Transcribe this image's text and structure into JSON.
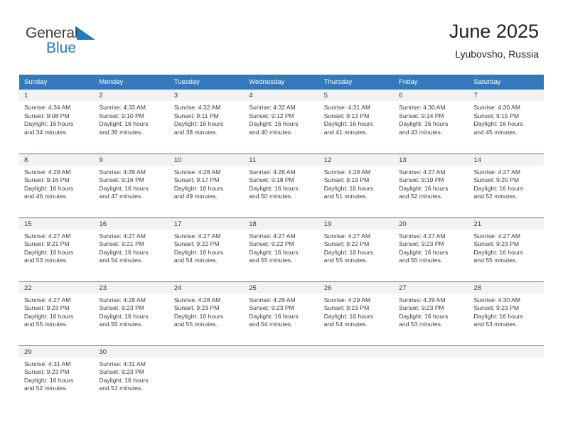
{
  "brand": {
    "name_part1": "General",
    "name_part2": "Blue",
    "triangle_color": "#1e7bc4",
    "text_color": "#3b3b3b"
  },
  "header": {
    "title": "June 2025",
    "subtitle": "Lyubovsho, Russia",
    "accent_color": "#3479ba"
  },
  "calendar": {
    "weekday_headers": [
      "Sunday",
      "Monday",
      "Tuesday",
      "Wednesday",
      "Thursday",
      "Friday",
      "Saturday"
    ],
    "weeks": [
      [
        {
          "day": "1",
          "sunrise": "Sunrise: 4:34 AM",
          "sunset": "Sunset: 9:08 PM",
          "daylight1": "Daylight: 16 hours",
          "daylight2": "and 34 minutes."
        },
        {
          "day": "2",
          "sunrise": "Sunrise: 4:33 AM",
          "sunset": "Sunset: 9:10 PM",
          "daylight1": "Daylight: 16 hours",
          "daylight2": "and 36 minutes."
        },
        {
          "day": "3",
          "sunrise": "Sunrise: 4:32 AM",
          "sunset": "Sunset: 9:11 PM",
          "daylight1": "Daylight: 16 hours",
          "daylight2": "and 38 minutes."
        },
        {
          "day": "4",
          "sunrise": "Sunrise: 4:32 AM",
          "sunset": "Sunset: 9:12 PM",
          "daylight1": "Daylight: 16 hours",
          "daylight2": "and 40 minutes."
        },
        {
          "day": "5",
          "sunrise": "Sunrise: 4:31 AM",
          "sunset": "Sunset: 9:13 PM",
          "daylight1": "Daylight: 16 hours",
          "daylight2": "and 41 minutes."
        },
        {
          "day": "6",
          "sunrise": "Sunrise: 4:30 AM",
          "sunset": "Sunset: 9:14 PM",
          "daylight1": "Daylight: 16 hours",
          "daylight2": "and 43 minutes."
        },
        {
          "day": "7",
          "sunrise": "Sunrise: 4:30 AM",
          "sunset": "Sunset: 9:15 PM",
          "daylight1": "Daylight: 16 hours",
          "daylight2": "and 45 minutes."
        }
      ],
      [
        {
          "day": "8",
          "sunrise": "Sunrise: 4:29 AM",
          "sunset": "Sunset: 9:16 PM",
          "daylight1": "Daylight: 16 hours",
          "daylight2": "and 46 minutes."
        },
        {
          "day": "9",
          "sunrise": "Sunrise: 4:29 AM",
          "sunset": "Sunset: 9:16 PM",
          "daylight1": "Daylight: 16 hours",
          "daylight2": "and 47 minutes."
        },
        {
          "day": "10",
          "sunrise": "Sunrise: 4:28 AM",
          "sunset": "Sunset: 9:17 PM",
          "daylight1": "Daylight: 16 hours",
          "daylight2": "and 49 minutes."
        },
        {
          "day": "11",
          "sunrise": "Sunrise: 4:28 AM",
          "sunset": "Sunset: 9:18 PM",
          "daylight1": "Daylight: 16 hours",
          "daylight2": "and 50 minutes."
        },
        {
          "day": "12",
          "sunrise": "Sunrise: 4:28 AM",
          "sunset": "Sunset: 9:19 PM",
          "daylight1": "Daylight: 16 hours",
          "daylight2": "and 51 minutes."
        },
        {
          "day": "13",
          "sunrise": "Sunrise: 4:27 AM",
          "sunset": "Sunset: 9:19 PM",
          "daylight1": "Daylight: 16 hours",
          "daylight2": "and 52 minutes."
        },
        {
          "day": "14",
          "sunrise": "Sunrise: 4:27 AM",
          "sunset": "Sunset: 9:20 PM",
          "daylight1": "Daylight: 16 hours",
          "daylight2": "and 52 minutes."
        }
      ],
      [
        {
          "day": "15",
          "sunrise": "Sunrise: 4:27 AM",
          "sunset": "Sunset: 9:21 PM",
          "daylight1": "Daylight: 16 hours",
          "daylight2": "and 53 minutes."
        },
        {
          "day": "16",
          "sunrise": "Sunrise: 4:27 AM",
          "sunset": "Sunset: 9:21 PM",
          "daylight1": "Daylight: 16 hours",
          "daylight2": "and 54 minutes."
        },
        {
          "day": "17",
          "sunrise": "Sunrise: 4:27 AM",
          "sunset": "Sunset: 9:22 PM",
          "daylight1": "Daylight: 16 hours",
          "daylight2": "and 54 minutes."
        },
        {
          "day": "18",
          "sunrise": "Sunrise: 4:27 AM",
          "sunset": "Sunset: 9:22 PM",
          "daylight1": "Daylight: 16 hours",
          "daylight2": "and 55 minutes."
        },
        {
          "day": "19",
          "sunrise": "Sunrise: 4:27 AM",
          "sunset": "Sunset: 9:22 PM",
          "daylight1": "Daylight: 16 hours",
          "daylight2": "and 55 minutes."
        },
        {
          "day": "20",
          "sunrise": "Sunrise: 4:27 AM",
          "sunset": "Sunset: 9:23 PM",
          "daylight1": "Daylight: 16 hours",
          "daylight2": "and 55 minutes."
        },
        {
          "day": "21",
          "sunrise": "Sunrise: 4:27 AM",
          "sunset": "Sunset: 9:23 PM",
          "daylight1": "Daylight: 16 hours",
          "daylight2": "and 55 minutes."
        }
      ],
      [
        {
          "day": "22",
          "sunrise": "Sunrise: 4:27 AM",
          "sunset": "Sunset: 9:23 PM",
          "daylight1": "Daylight: 16 hours",
          "daylight2": "and 55 minutes."
        },
        {
          "day": "23",
          "sunrise": "Sunrise: 4:28 AM",
          "sunset": "Sunset: 9:23 PM",
          "daylight1": "Daylight: 16 hours",
          "daylight2": "and 55 minutes."
        },
        {
          "day": "24",
          "sunrise": "Sunrise: 4:28 AM",
          "sunset": "Sunset: 9:23 PM",
          "daylight1": "Daylight: 16 hours",
          "daylight2": "and 55 minutes."
        },
        {
          "day": "25",
          "sunrise": "Sunrise: 4:29 AM",
          "sunset": "Sunset: 9:23 PM",
          "daylight1": "Daylight: 16 hours",
          "daylight2": "and 54 minutes."
        },
        {
          "day": "26",
          "sunrise": "Sunrise: 4:29 AM",
          "sunset": "Sunset: 9:23 PM",
          "daylight1": "Daylight: 16 hours",
          "daylight2": "and 54 minutes."
        },
        {
          "day": "27",
          "sunrise": "Sunrise: 4:29 AM",
          "sunset": "Sunset: 9:23 PM",
          "daylight1": "Daylight: 16 hours",
          "daylight2": "and 53 minutes."
        },
        {
          "day": "28",
          "sunrise": "Sunrise: 4:30 AM",
          "sunset": "Sunset: 9:23 PM",
          "daylight1": "Daylight: 16 hours",
          "daylight2": "and 53 minutes."
        }
      ],
      [
        {
          "day": "29",
          "sunrise": "Sunrise: 4:31 AM",
          "sunset": "Sunset: 9:23 PM",
          "daylight1": "Daylight: 16 hours",
          "daylight2": "and 52 minutes."
        },
        {
          "day": "30",
          "sunrise": "Sunrise: 4:31 AM",
          "sunset": "Sunset: 9:23 PM",
          "daylight1": "Daylight: 16 hours",
          "daylight2": "and 51 minutes."
        },
        {
          "day": "",
          "sunrise": "",
          "sunset": "",
          "daylight1": "",
          "daylight2": ""
        },
        {
          "day": "",
          "sunrise": "",
          "sunset": "",
          "daylight1": "",
          "daylight2": ""
        },
        {
          "day": "",
          "sunrise": "",
          "sunset": "",
          "daylight1": "",
          "daylight2": ""
        },
        {
          "day": "",
          "sunrise": "",
          "sunset": "",
          "daylight1": "",
          "daylight2": ""
        },
        {
          "day": "",
          "sunrise": "",
          "sunset": "",
          "daylight1": "",
          "daylight2": ""
        }
      ]
    ]
  }
}
